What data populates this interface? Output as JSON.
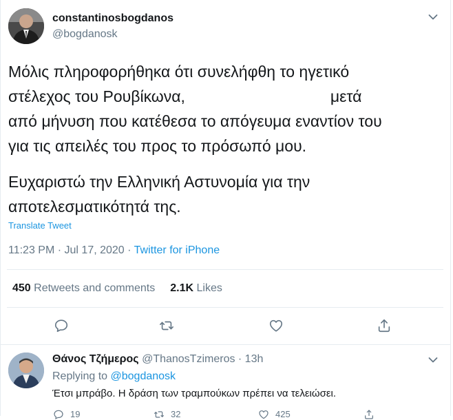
{
  "tweet": {
    "display_name": "constantinosbogdanos",
    "handle": "@bogdanosk",
    "text_lines": [
      "Μόλις πληροφορήθηκα ότι συνελήφθη το ηγετικό",
      "στέλεχος του Ρουβίκωνα,                                 μετά",
      "από μήνυση που κατέθεσα το απόγευμα εναντίον του",
      "για τις απειλές του προς το πρόσωπό μου.",
      "Ευχαριστώ την Ελληνική Αστυνομία για την",
      "αποτελεσματικότητά της."
    ],
    "translate_label": "Translate Tweet",
    "timestamp": "11:23 PM · Jul 17, 2020 · ",
    "source": "Twitter for iPhone",
    "retweets_count": "450",
    "retweets_label": "Retweets and comments",
    "likes_count": "2.1K",
    "likes_label": "Likes"
  },
  "actions": {
    "reply_icon": "reply-icon",
    "retweet_icon": "retweet-icon",
    "like_icon": "heart-icon",
    "share_icon": "share-icon"
  },
  "reply": {
    "display_name": "Θάνος Τζήμερος",
    "handle_time": " @ThanosTzimeros · 13h",
    "replying_prefix": "Replying to ",
    "replying_to": "@bogdanosk",
    "text": "Έτσι μπράβο. Η δράση των τραμπούκων πρέπει να τελειώσει.",
    "reply_count": "19",
    "retweet_count": "32",
    "like_count": "425"
  },
  "colors": {
    "accent": "#1b95e0",
    "muted": "#657786",
    "text": "#14171a",
    "divider": "#e6ecf0"
  }
}
